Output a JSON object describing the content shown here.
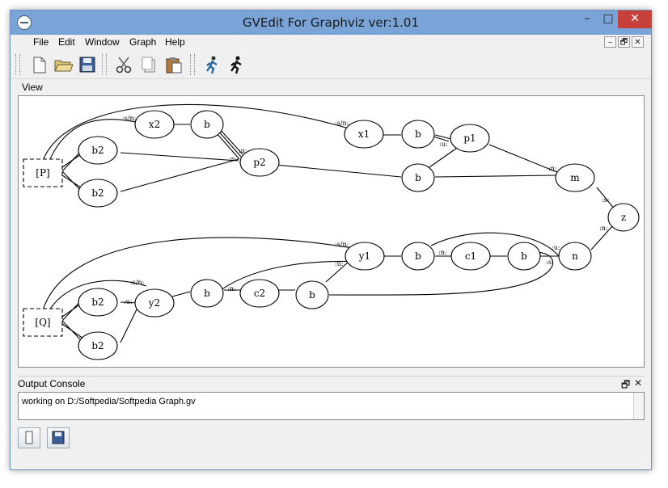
{
  "window": {
    "title": "GVEdit For Graphviz ver:1.01",
    "min": "–",
    "max": "□",
    "close": "✕"
  },
  "menu": [
    "File",
    "Edit",
    "Window",
    "Graph",
    "Help"
  ],
  "mdi": {
    "min": "–",
    "restore": "🗗",
    "close": "✕"
  },
  "toolbar": {
    "icons": [
      "new-file-icon",
      "open-folder-icon",
      "save-icon",
      "cut-icon",
      "copy-icon",
      "paste-icon",
      "layout-run-icon",
      "run-icon"
    ]
  },
  "view_label": "View",
  "graph": {
    "nodes": {
      "P": "[P]",
      "Q": "[Q]",
      "b2a": "b2",
      "b2b": "b2",
      "x2": "x2",
      "bx2": "b",
      "p2": "p2",
      "x1": "x1",
      "bx1": "b",
      "p1": "p1",
      "bp2": "b",
      "m": "m",
      "z": "z",
      "y1": "y1",
      "by1": "b",
      "c1": "c1",
      "bc1": "b",
      "n": "n",
      "b2c": "b2",
      "b2d": "b2",
      "y2": "y2",
      "by2": "b",
      "c2": "c2",
      "bc2": "b"
    },
    "edge_labels": {
      "l1": ":s/n:",
      "l2": ":u:",
      "l3": ":s:",
      "l4": ":s/n:",
      "l5": ":u:",
      "l6": ":n:",
      "l7": ":s:",
      "l8": ":n:",
      "l9": ":s/n:",
      "l10": ":u:",
      "l11": ":n:",
      "l12": ":u:",
      "l13": ":s:",
      "l14": ":s/n:",
      "l15": ":u:",
      "l16": ":n:"
    }
  },
  "console": {
    "title": "Output Console",
    "text": "working on D:/Softpedia/Softpedia Graph.gv",
    "restore": "🗗",
    "close": "✕"
  },
  "bottom_buttons": [
    "clear-icon",
    "save-log-icon"
  ]
}
